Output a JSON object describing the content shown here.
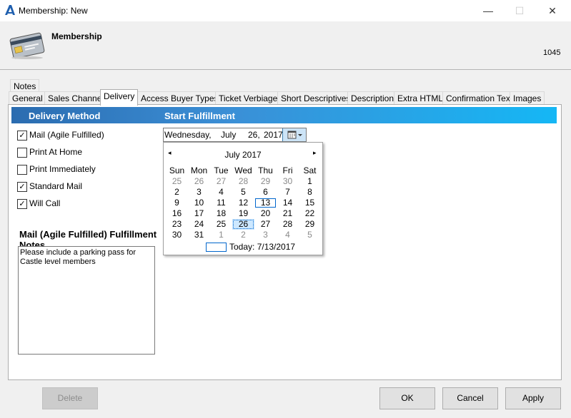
{
  "window": {
    "title": "Membership: New",
    "minimize_glyph": "—",
    "maximize_glyph": "☐",
    "close_glyph": "✕"
  },
  "header": {
    "title": "Membership",
    "record_id": "1045",
    "icon": "membership-card-icon"
  },
  "tabs": {
    "notes_label": "Notes",
    "items": [
      {
        "label": "General"
      },
      {
        "label": "Sales Channel"
      },
      {
        "label": "Delivery"
      },
      {
        "label": "Access Buyer Types"
      },
      {
        "label": "Ticket Verbiage"
      },
      {
        "label": "Short Descriptives"
      },
      {
        "label": "Description"
      },
      {
        "label": "Extra HTML"
      },
      {
        "label": "Confirmation Text"
      },
      {
        "label": "Images"
      }
    ],
    "active": "Delivery"
  },
  "delivery": {
    "method_header": "Delivery Method",
    "fulfillment_header": "Start Fulfillment",
    "methods": [
      {
        "label": "Mail (Agile Fulfilled)",
        "checked": true
      },
      {
        "label": "Print At Home",
        "checked": false
      },
      {
        "label": "Print Immediately",
        "checked": false
      },
      {
        "label": "Standard Mail",
        "checked": true
      },
      {
        "label": "Will Call",
        "checked": true
      }
    ],
    "check_glyph": "✓",
    "notes_heading": "Mail (Agile Fulfilled) Fulfillment Notes",
    "notes_text": "Please include a parking pass for Castle level members"
  },
  "date_picker": {
    "day_of_week": "Wednesday,",
    "month": "July",
    "day": "26,",
    "year": "2017",
    "button_icon": "calendar-dropdown-icon"
  },
  "calendar": {
    "month_label": "July 2017",
    "prev_glyph": "◂",
    "next_glyph": "▸",
    "weekdays": [
      "Sun",
      "Mon",
      "Tue",
      "Wed",
      "Thu",
      "Fri",
      "Sat"
    ],
    "weeks": [
      [
        "25",
        "26",
        "27",
        "28",
        "29",
        "30",
        "1"
      ],
      [
        "2",
        "3",
        "4",
        "5",
        "6",
        "7",
        "8"
      ],
      [
        "9",
        "10",
        "11",
        "12",
        "13",
        "14",
        "15"
      ],
      [
        "16",
        "17",
        "18",
        "19",
        "20",
        "21",
        "22"
      ],
      [
        "23",
        "24",
        "25",
        "26",
        "27",
        "28",
        "29"
      ],
      [
        "30",
        "31",
        "1",
        "2",
        "3",
        "4",
        "5"
      ]
    ],
    "today_label": "Today: 7/13/2017",
    "today_day": "13",
    "selected_day": "26"
  },
  "buttons": {
    "delete": "Delete",
    "ok": "OK",
    "cancel": "Cancel",
    "apply": "Apply"
  },
  "colors": {
    "accent": "#2b6cb0",
    "bar_end": "#15b7f5"
  }
}
